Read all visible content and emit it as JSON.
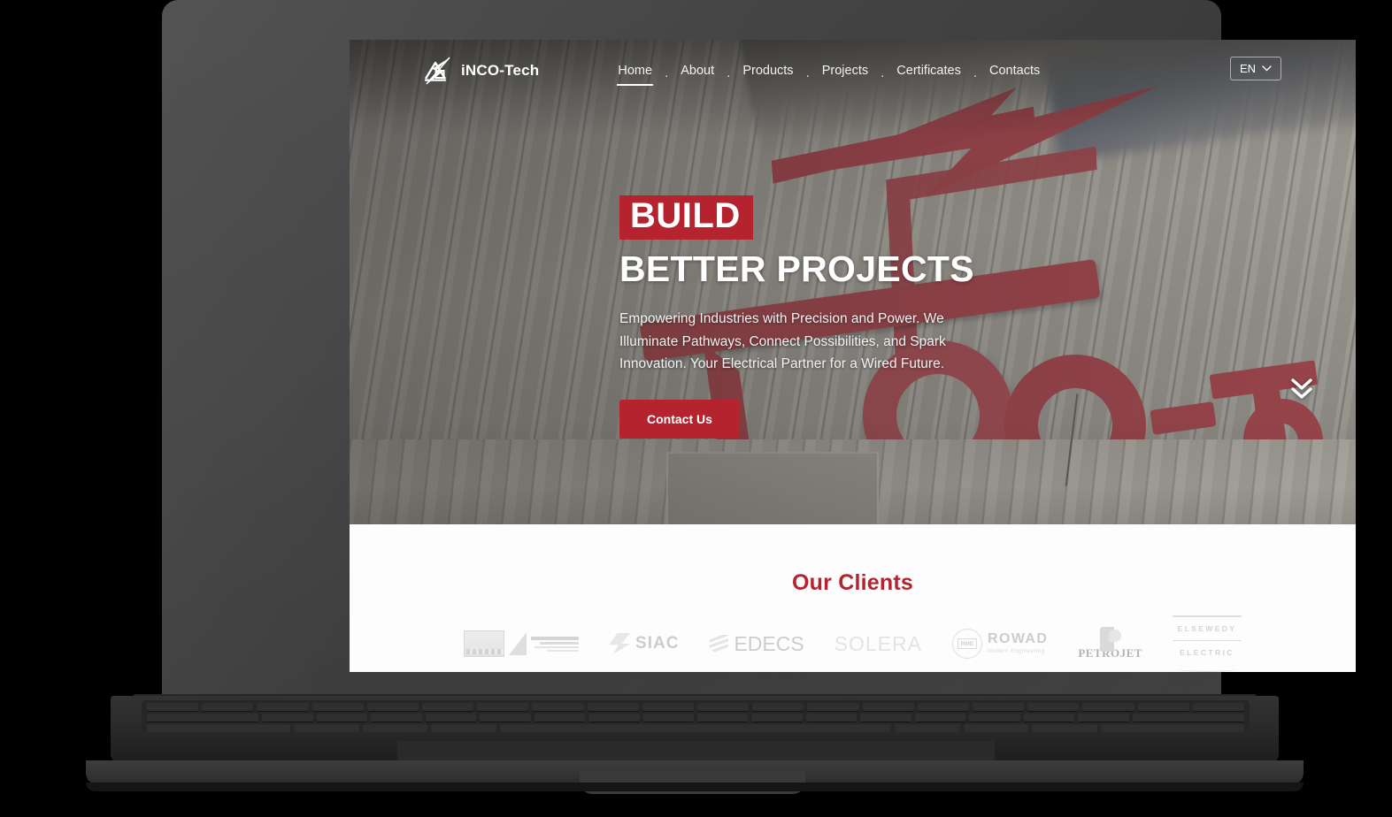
{
  "site": {
    "brand": {
      "name": "iNCO-Tech",
      "icon": "building-bolt-logo-icon"
    },
    "nav": {
      "items": [
        {
          "label": "Home",
          "active": true
        },
        {
          "label": "About",
          "active": false
        },
        {
          "label": "Products",
          "active": false
        },
        {
          "label": "Projects",
          "active": false
        },
        {
          "label": "Certificates",
          "active": false
        },
        {
          "label": "Contacts",
          "active": false
        }
      ],
      "separator": "."
    },
    "language": {
      "value": "EN",
      "icon": "chevron-down-icon"
    }
  },
  "hero": {
    "title_highlight": "BUILD",
    "title_rest": "BETTER PROJECTS",
    "paragraph": "Empowering Industries with Precision and Power. We Illuminate Pathways, Connect Possibilities, and Spark Innovation. Your Electrical Partner for a Wired Future.",
    "cta_label": "Contact Us",
    "scroll_icon": "double-chevron-down-icon",
    "background_alt": "iNCO-Tech signage on corrugated metal building facade"
  },
  "clients": {
    "title": "Our Clients",
    "logos": [
      {
        "name": "Children's Cancer Hospital Egypt",
        "text": ""
      },
      {
        "name": "SIAC",
        "text": "SIAC"
      },
      {
        "name": "EDECS",
        "text": "EDECS"
      },
      {
        "name": "SOLERA",
        "text": "SOLERA"
      },
      {
        "name": "ROWAD Modern Engineering",
        "text": "ROWAD",
        "subtext": "Modern Engineering",
        "badge": "RME"
      },
      {
        "name": "PETROJET",
        "text": "PETROJET"
      },
      {
        "name": "ELSEWEDY ELECTRIC",
        "line1": "ELSEWEDY",
        "line2": "ELECTRIC"
      }
    ]
  },
  "colors": {
    "brand_red": "#b5232f",
    "nav_text": "#f2f2f2",
    "clients_bg": "#fdfdfd",
    "laptop_body": "#434343"
  },
  "device": {
    "type": "laptop-mockup"
  }
}
